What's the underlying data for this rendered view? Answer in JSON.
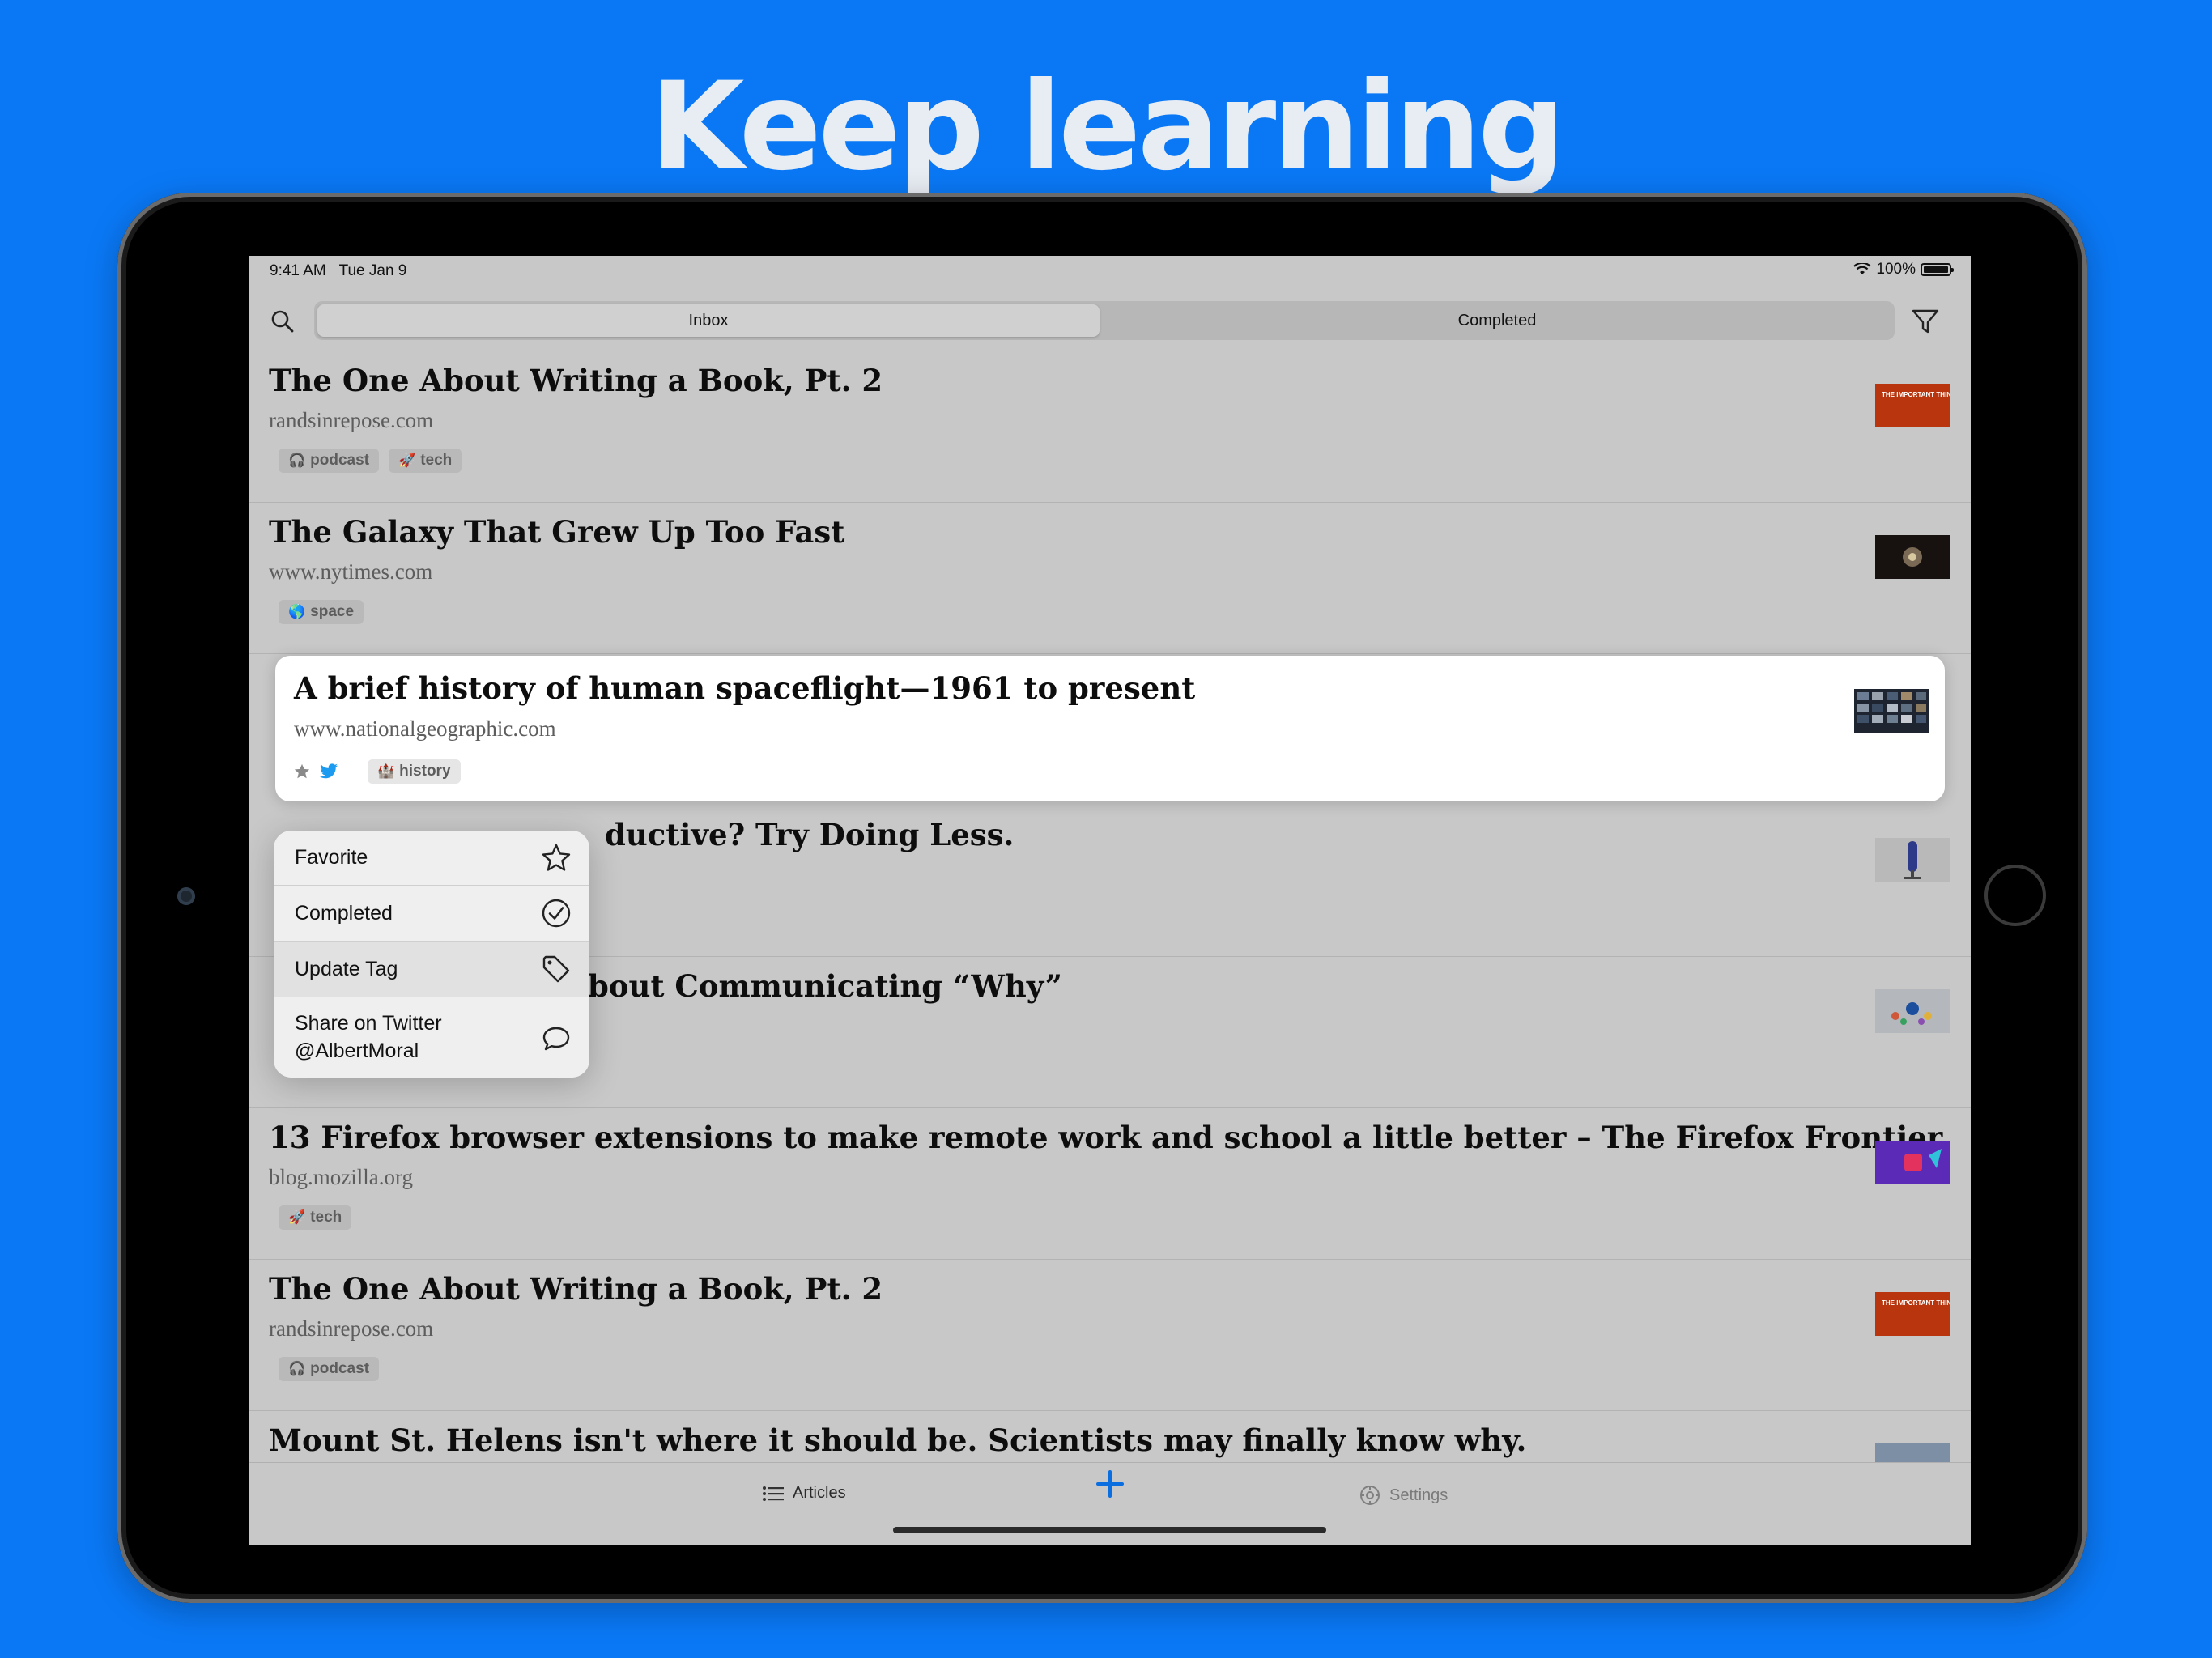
{
  "headline": "Keep learning",
  "status": {
    "time": "9:41 AM",
    "date": "Tue Jan 9",
    "battery": "100%"
  },
  "segments": {
    "inbox": "Inbox",
    "completed": "Completed"
  },
  "articles": [
    {
      "title": "The One About Writing a Book, Pt. 2",
      "domain": "randsinrepose.com",
      "tags": [
        {
          "emoji": "🎧",
          "label": "podcast"
        },
        {
          "emoji": "🚀",
          "label": "tech"
        }
      ],
      "thumb_text": "THE IMPORTANT THING"
    },
    {
      "title": "The Galaxy That Grew Up Too Fast",
      "domain": "www.nytimes.com",
      "tags": [
        {
          "emoji": "🌎",
          "label": "space"
        }
      ]
    },
    {
      "title": "A brief history of human spaceflight—1961 to present",
      "domain": "www.nationalgeographic.com",
      "tags": [
        {
          "emoji": "🏰",
          "label": "history"
        }
      ]
    },
    {
      "title": "ductive? Try Doing Less."
    },
    {
      "title": "bout Communicating “Why”"
    },
    {
      "title": "13 Firefox browser extensions to make remote work and school a little better – The Firefox Frontier",
      "domain": "blog.mozilla.org",
      "tags": [
        {
          "emoji": "🚀",
          "label": "tech"
        }
      ]
    },
    {
      "title": "The One About Writing a Book, Pt. 2",
      "domain": "randsinrepose.com",
      "tags": [
        {
          "emoji": "🎧",
          "label": "podcast"
        }
      ],
      "thumb_text": "THE IMPORTANT THING"
    },
    {
      "title": "Mount St. Helens isn't where it should be. Scientists may finally know why."
    }
  ],
  "context_menu": {
    "favorite": "Favorite",
    "completed": "Completed",
    "update_tag": "Update Tag",
    "share_line1": "Share on Twitter",
    "share_line2": "@AlbertMoral"
  },
  "tabbar": {
    "articles": "Articles",
    "settings": "Settings"
  },
  "colors": {
    "background": "#0a78f5",
    "accent": "#0a6ee0",
    "twitter": "#1d9bf0"
  }
}
